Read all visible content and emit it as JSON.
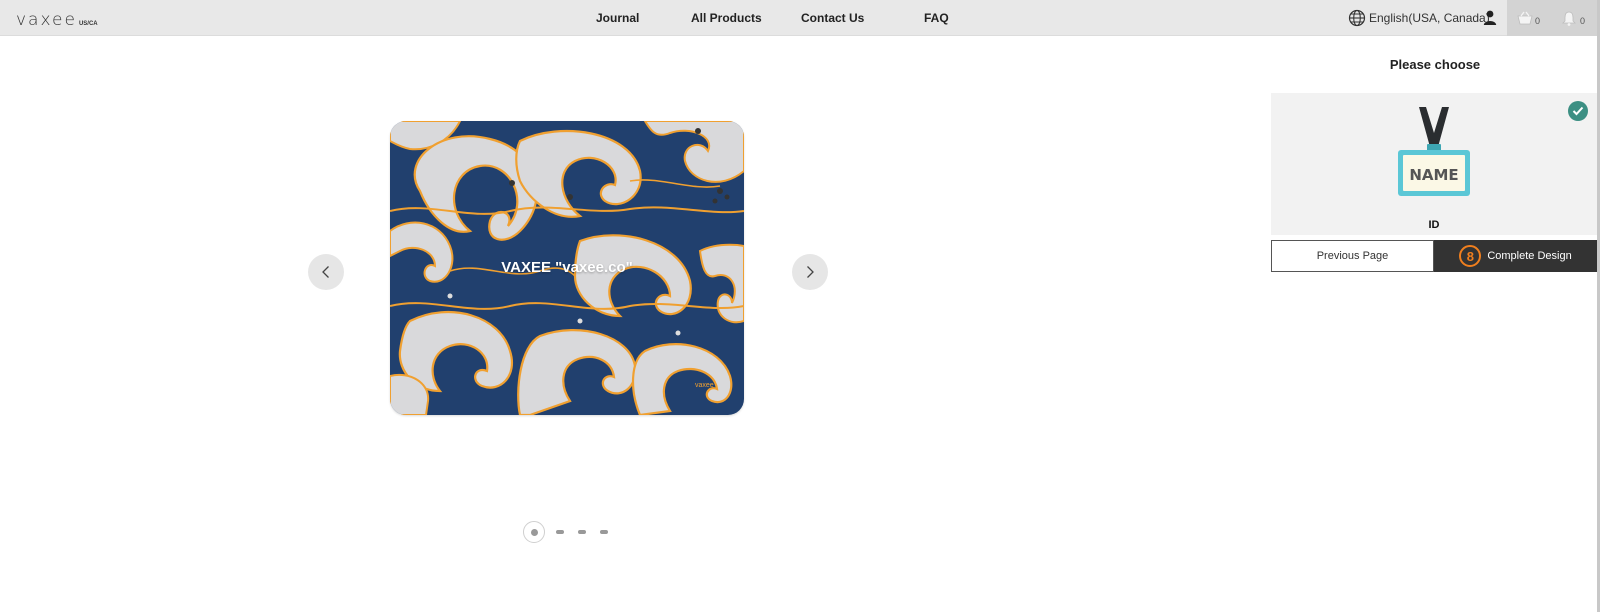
{
  "header": {
    "logo": "vaxee",
    "logo_region": "US/CA",
    "nav": [
      "Journal",
      "All Products",
      "Contact Us",
      "FAQ"
    ],
    "language": "English(USA, Canada)",
    "cart_count": "0",
    "notification_count": "0"
  },
  "carousel": {
    "image_text": "VAXEE \"vaxee.co\"",
    "slide_count": 4,
    "active_slide": 1
  },
  "panel": {
    "title": "Please choose",
    "badge_word": "NAME",
    "option_label": "ID",
    "previous_label": "Previous Page",
    "complete_label": "Complete Design",
    "step_number": "8"
  },
  "colors": {
    "accent_orange": "#f07f1e",
    "check_teal": "#3c8f83",
    "wave_blue": "#21406e"
  }
}
